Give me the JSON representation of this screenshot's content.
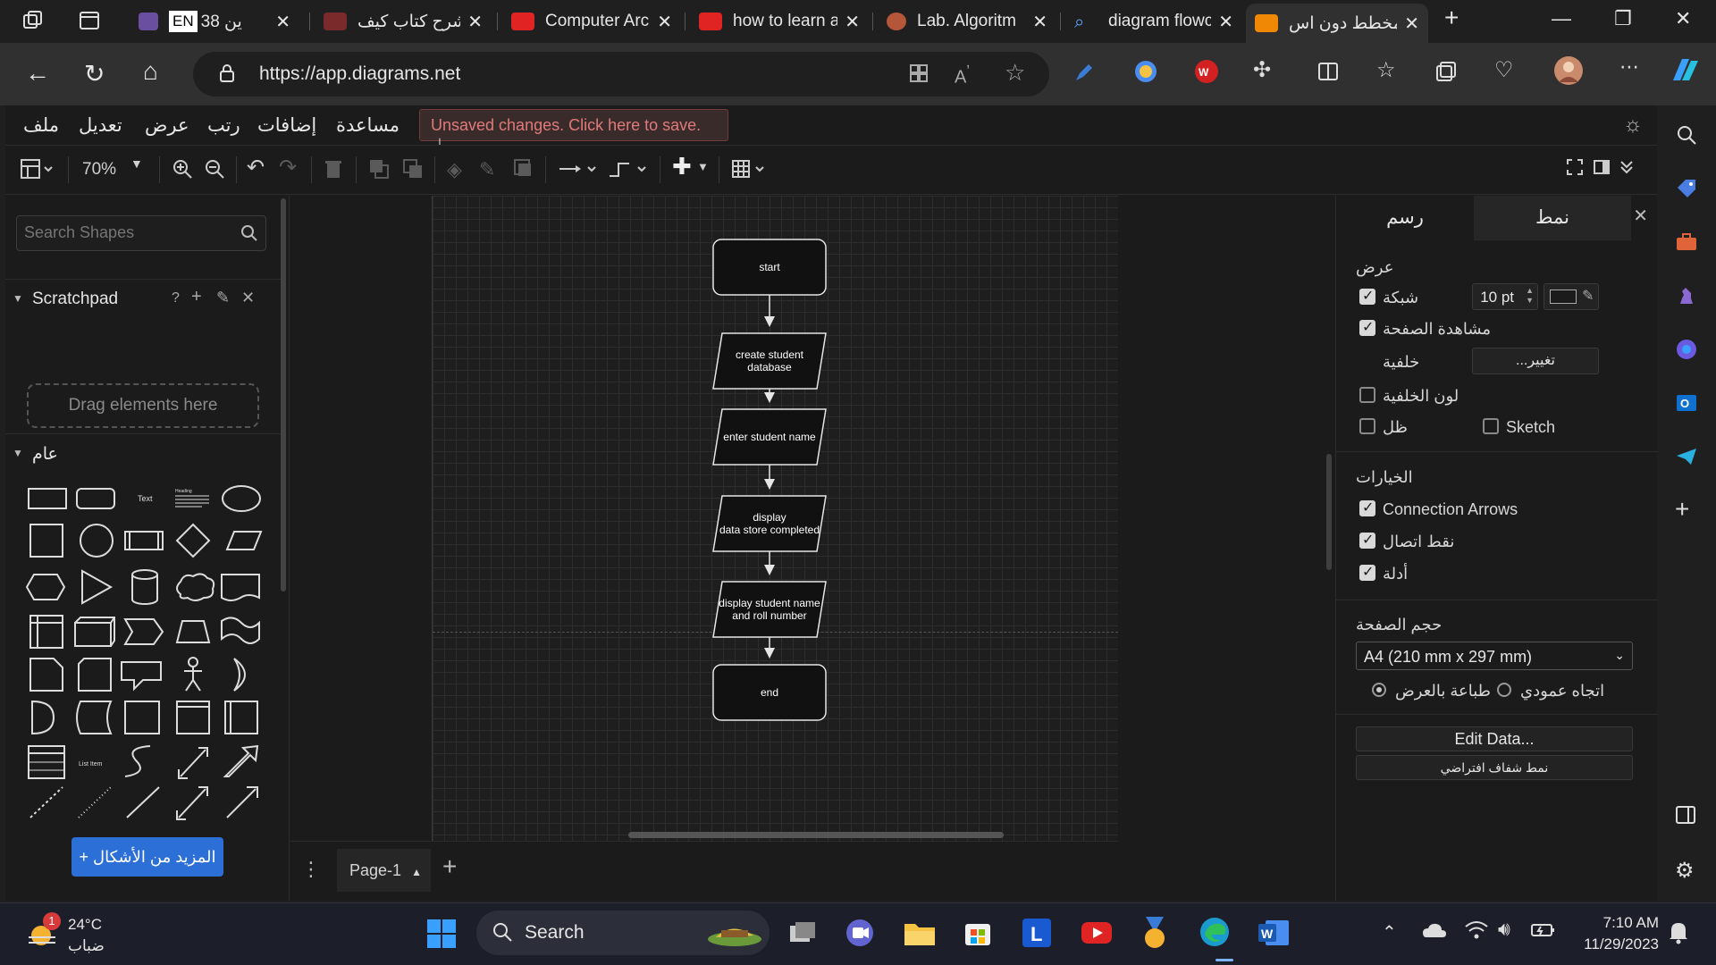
{
  "browser": {
    "tabs": [
      {
        "title": "ين 38",
        "prefix": "EN",
        "color": "#6a4fa0"
      },
      {
        "title": "شرح كتاب كيف",
        "color": "#e02424"
      },
      {
        "title": "Computer Arc",
        "color": "#e02424"
      },
      {
        "title": "how to learn a",
        "color": "#e02424"
      },
      {
        "title": "Lab. Algoritm",
        "color": "#b5553a"
      },
      {
        "title": "diagram flowc",
        "color": "#3a7bd5"
      },
      {
        "title": "مخطط دون اس",
        "color": "#f08705"
      }
    ],
    "url": "https://app.diagrams.net"
  },
  "menu": {
    "file": "ملف",
    "edit": "تعديل",
    "view": "عرض",
    "arrange": "رتب",
    "extras": "إضافات",
    "help": "مساعدة",
    "unsaved": "Unsaved changes. Click here to save."
  },
  "toolbar": {
    "zoom": "70%"
  },
  "left": {
    "search_placeholder": "Search Shapes",
    "scratchpad": "Scratchpad",
    "scratch_help": "?",
    "drag_here": "Drag elements here",
    "general": "عام",
    "text_shape": "Text",
    "heading_shape": "Heading",
    "list_item_shape": "List Item",
    "more_shapes": "+ المزيد من الأشكال"
  },
  "diagram": {
    "nodes": [
      {
        "id": "start",
        "text": "start",
        "shape": "terminal"
      },
      {
        "id": "create",
        "text": "create student\ndatabase",
        "shape": "io"
      },
      {
        "id": "enter",
        "text": "enter student name",
        "shape": "io"
      },
      {
        "id": "display1",
        "text": "display\ndata store completed",
        "shape": "io"
      },
      {
        "id": "display2",
        "text": "display student name\nand roll number",
        "shape": "io"
      },
      {
        "id": "end",
        "text": "end",
        "shape": "terminal"
      }
    ]
  },
  "pages": {
    "current": "Page-1"
  },
  "format": {
    "tab_diagram": "رسم",
    "tab_style": "نمط",
    "view_title": "عرض",
    "grid": "شبكة",
    "grid_checked": true,
    "grid_size": "10 pt",
    "page_view": "مشاهدة الصفحة",
    "page_view_checked": true,
    "background": "خلفية",
    "change": "...تغيير",
    "bg_color": "لون الخلفية",
    "bg_color_checked": false,
    "shadow": "ظل",
    "shadow_checked": false,
    "sketch": "Sketch",
    "sketch_checked": false,
    "options_title": "الخيارات",
    "connection_arrows": "Connection Arrows",
    "connection_points": "نقط اتصال",
    "guides": "أدلة",
    "page_size_title": "حجم الصفحة",
    "page_size": "A4 (210 mm x 297 mm)",
    "landscape": "طباعة بالعرض",
    "portrait": "اتجاه عمودي",
    "edit_data": "Edit Data...",
    "default_style": "نمط شفاف افتراضي"
  },
  "taskbar": {
    "temp": "24°C",
    "weather": "ضباب",
    "weather_badge": "1",
    "search": "Search",
    "time": "7:10 AM",
    "date": "11/29/2023"
  }
}
